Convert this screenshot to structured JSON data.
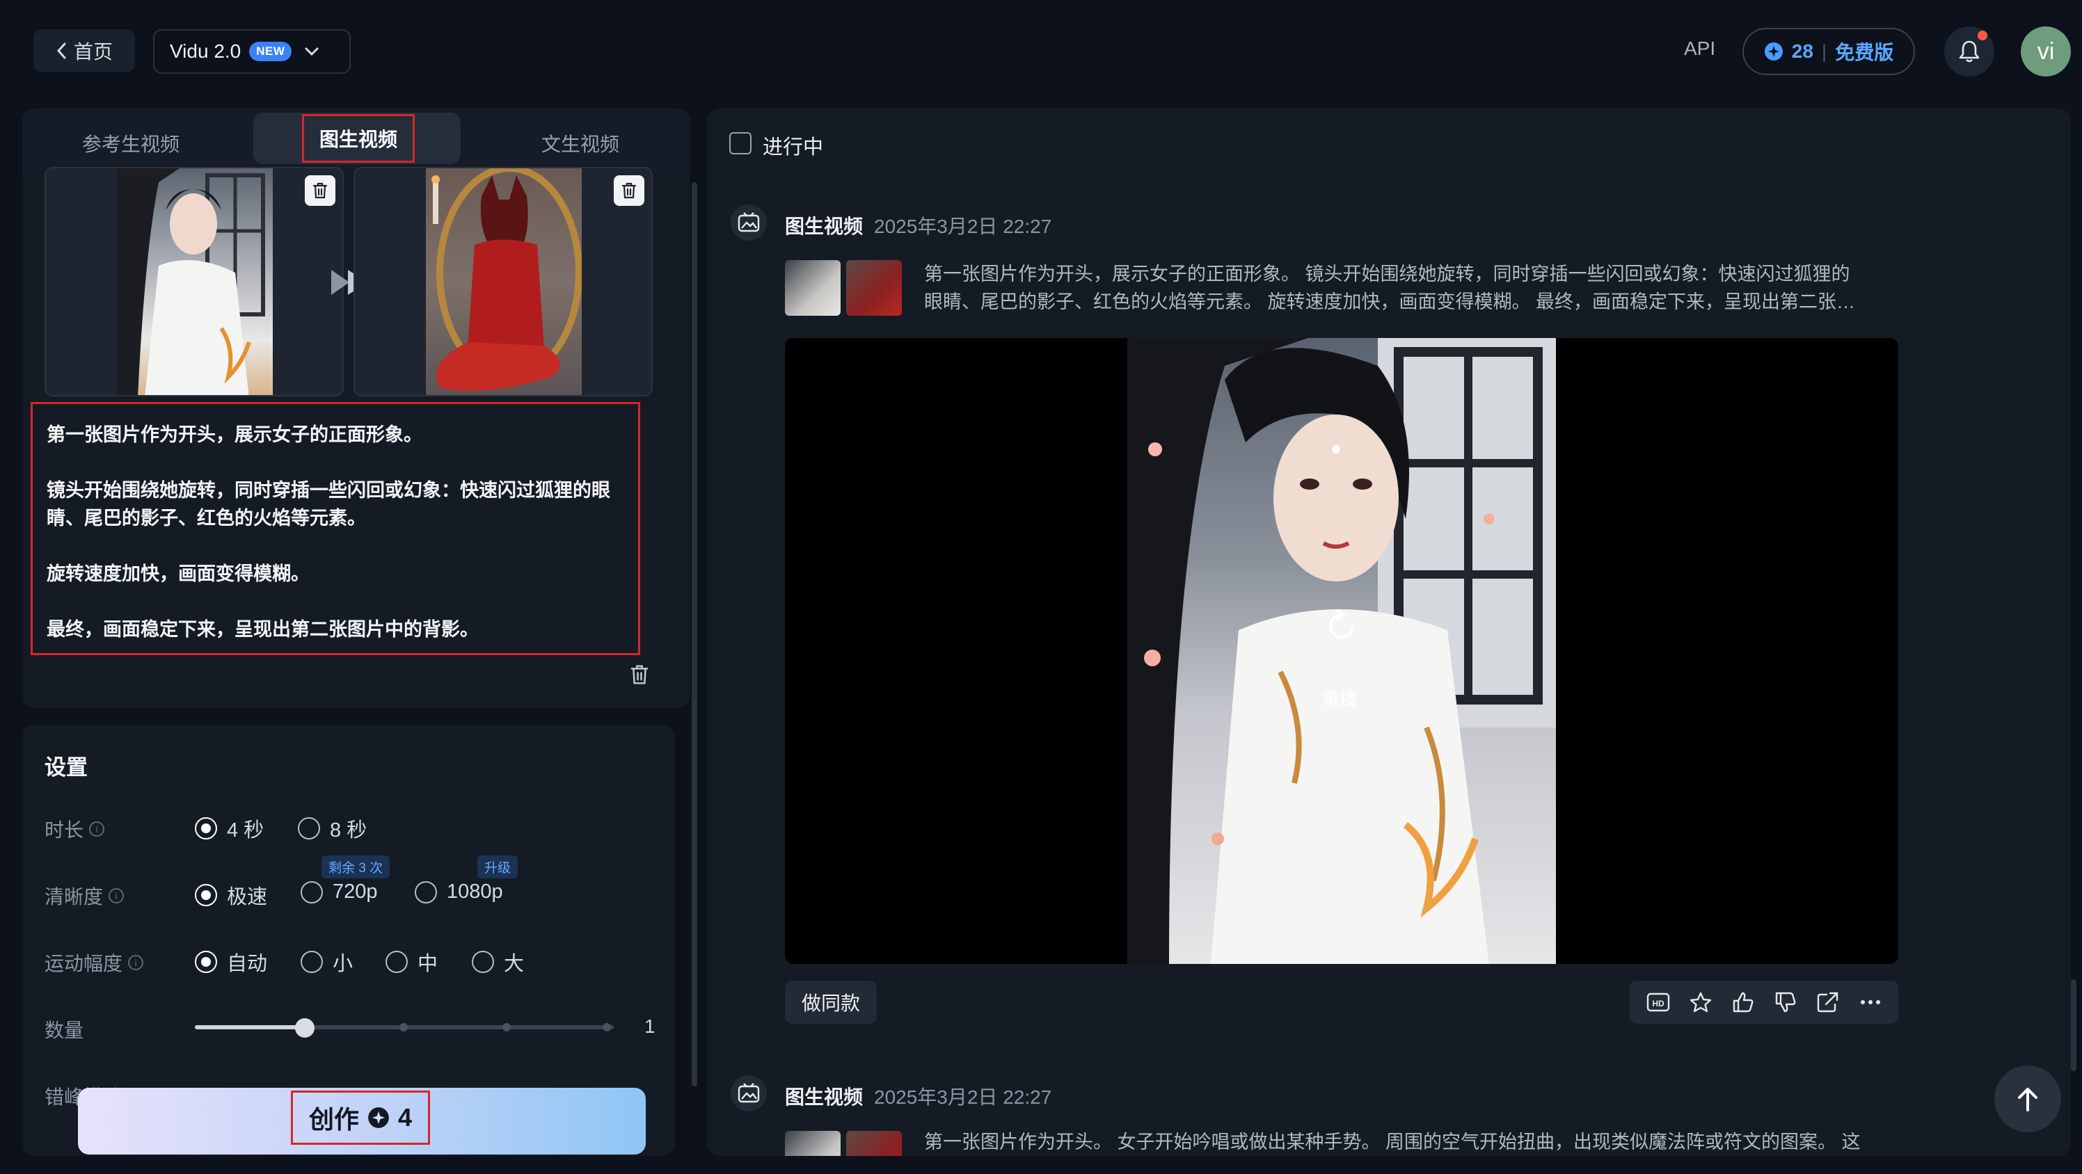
{
  "header": {
    "home_label": "首页",
    "model_name": "Vidu 2.0",
    "model_badge": "NEW",
    "api_label": "API",
    "credits": "28",
    "plan_label": "免费版",
    "avatar_text": "vi"
  },
  "tabs": [
    {
      "label": "参考生视频"
    },
    {
      "label": "图生视频"
    },
    {
      "label": "文生视频"
    }
  ],
  "prompt": {
    "paragraphs": [
      "第一张图片作为开头，展示女子的正面形象。",
      "镜头开始围绕她旋转，同时穿插一些闪回或幻象：快速闪过狐狸的眼睛、尾巴的影子、红色的火焰等元素。",
      "旋转速度加快，画面变得模糊。",
      "最终，画面稳定下来，呈现出第二张图片中的背影。"
    ]
  },
  "settings": {
    "title": "设置",
    "duration": {
      "label": "时长",
      "options": [
        "4 秒",
        "8 秒"
      ],
      "selected": "4 秒"
    },
    "resolution": {
      "label": "清晰度",
      "options": [
        "极速",
        "720p",
        "1080p"
      ],
      "selected": "极速",
      "badge_720": "剩余 3 次",
      "badge_1080": "升级"
    },
    "motion": {
      "label": "运动幅度",
      "options": [
        "自动",
        "小",
        "中",
        "大"
      ],
      "selected": "自动"
    },
    "quantity": {
      "label": "数量",
      "value": "1",
      "level": 0.25
    },
    "peak_mode": {
      "label": "错峰模式"
    }
  },
  "create": {
    "label": "创作",
    "cost": "4"
  },
  "feed": {
    "filter_label": "进行中",
    "items": [
      {
        "type": "图生视频",
        "time": "2025年3月2日 22:27",
        "prompt_line1": "第一张图片作为开头，展示女子的正面形象。 镜头开始围绕她旋转，同时穿插一些闪回或幻象：快速闪过狐狸的",
        "prompt_line2": "眼睛、尾巴的影子、红色的火焰等元素。 旋转速度加快，画面变得模糊。 最终，画面稳定下来，呈现出第二张…",
        "replay_label": "重播",
        "same_label": "做同款"
      },
      {
        "type": "图生视频",
        "time": "2025年3月2日 22:27",
        "prompt_line1": "第一张图片作为开头。 女子开始吟唱或做出某种手势。 周围的空气开始扭曲，出现类似魔法阵或符文的图案。 这"
      }
    ]
  },
  "icons": {
    "back": "chevron-left-icon",
    "dropdown": "chevron-down-icon",
    "credit": "credit-icon",
    "bell": "bell-icon",
    "trash": "trash-icon",
    "arrow": "arrow-right-icon",
    "info": "info-icon",
    "feed_type": "image-to-video-icon",
    "replay": "replay-icon",
    "hd": "hd-icon",
    "star": "star-icon",
    "like": "thumbs-up-icon",
    "dislike": "thumbs-down-icon",
    "share": "share-icon",
    "more": "more-icon",
    "top": "arrow-up-icon"
  },
  "colors": {
    "accent": "#3b82f6",
    "highlight_border": "#d42828",
    "background": "#0c111b"
  }
}
